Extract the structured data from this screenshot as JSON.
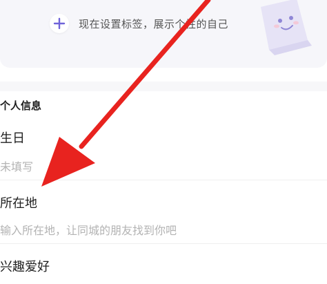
{
  "tag_banner": {
    "add_text": "现在设置标签，展示个性的自己",
    "add_icon": "plus-icon",
    "accent_color": "#6f63d9",
    "mascot_icon": "paper-bag-mascot-icon"
  },
  "personal_info": {
    "section_title": "个人信息",
    "fields": [
      {
        "label": "生日",
        "value": "未填写"
      },
      {
        "label": "所在地",
        "value": "输入所在地，让同城的朋友找到你吧"
      },
      {
        "label": "兴趣爱好",
        "value": ""
      }
    ]
  },
  "annotation": {
    "arrow_color": "#e8231f",
    "arrow_icon": "red-arrow-icon"
  }
}
